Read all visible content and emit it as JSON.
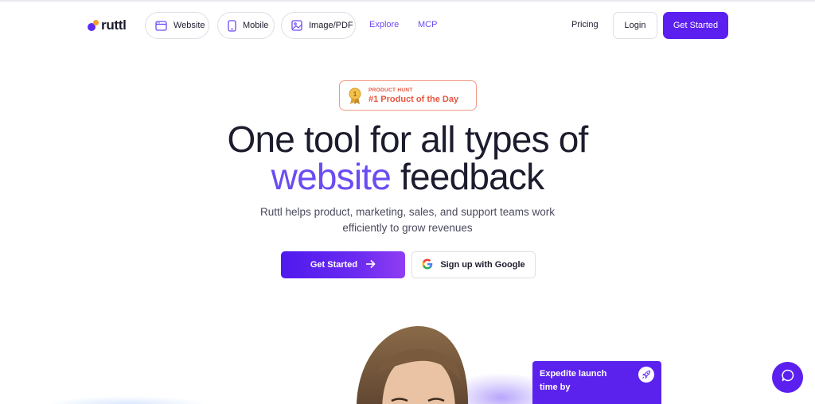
{
  "nav": {
    "logo_text": "ruttl",
    "pills": {
      "website": "Website",
      "mobile": "Mobile",
      "image_pdf": "Image/PDF"
    },
    "explore": "Explore",
    "mcp": "MCP",
    "pricing": "Pricing",
    "login": "Login",
    "get_started": "Get Started"
  },
  "badge": {
    "small": "PRODUCT HUNT",
    "big": "#1 Product of the Day"
  },
  "hero": {
    "line1": "One tool for all types of",
    "accent": "website",
    "rest": " feedback",
    "subtitle": "Ruttl helps product, marketing, sales, and support teams work efficiently to grow revenues"
  },
  "cta": {
    "primary": "Get Started",
    "google": "Sign up with Google"
  },
  "promo_card": {
    "text": "Expedite launch time by"
  },
  "colors": {
    "brand": "#5b1ff0",
    "accent_text": "#6a4cf2",
    "badge": "#e8553d",
    "logo_orange": "#f9a024"
  },
  "icons": [
    "browser-icon",
    "phone-icon",
    "image-icon",
    "medal-icon",
    "arrow-right-icon",
    "google-icon",
    "rocket-icon",
    "chat-icon"
  ]
}
